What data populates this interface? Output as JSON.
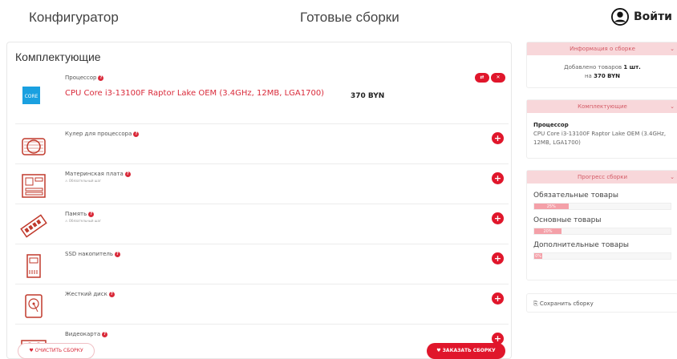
{
  "header": {
    "nav_configurator": "Конфигуратор",
    "nav_builds": "Готовые сборки",
    "login_label": "Войти"
  },
  "components": {
    "title": "Комплектующие",
    "items": [
      {
        "label": "Процессор",
        "product": "CPU Core i3-13100F Raptor Lake OEM (3.4GHz, 12MB, LGA1700)",
        "price": "370 BYN",
        "icon": "cpu-icon",
        "selected": true
      },
      {
        "label": "Кулер для процессора",
        "icon": "cooler-icon"
      },
      {
        "label": "Материнская плата",
        "sub": "⚠ Обязательный шаг",
        "icon": "motherboard-icon"
      },
      {
        "label": "Память",
        "sub": "⚠ Обязательный шаг",
        "icon": "ram-icon"
      },
      {
        "label": "SSD накопитель",
        "icon": "ssd-icon"
      },
      {
        "label": "Жесткий диск",
        "icon": "hdd-icon"
      },
      {
        "label": "Видеокарта",
        "icon": "gpu-icon"
      }
    ],
    "clear_button": "♥ ОЧИСТИТЬ СБОРКУ",
    "order_button": "♥ ЗАКАЗАТЬ СБОРКУ"
  },
  "sidebar": {
    "info": {
      "title": "Информация о сборке",
      "line1_prefix": "Добавлено товаров",
      "line1_value": "1 шт.",
      "line2_prefix": "на",
      "line2_value": "370 BYN"
    },
    "components": {
      "title": "Комплектующие",
      "category": "Процессор",
      "product": "CPU Core i3-13100F Raptor Lake OEM (3.4GHz, 12MB, LGA1700)"
    },
    "progress": {
      "title": "Прогресс сборки",
      "bars": [
        {
          "label": "Обязательные товары",
          "percent": 25,
          "text": "25%"
        },
        {
          "label": "Основные товары",
          "percent": 20,
          "text": "20%"
        },
        {
          "label": "Дополнительные товары",
          "percent": 0,
          "text": "0%"
        }
      ]
    },
    "save_label": "Сохранить сборку"
  },
  "colors": {
    "accent": "#e0162b",
    "accent_light": "#f8d7da"
  }
}
